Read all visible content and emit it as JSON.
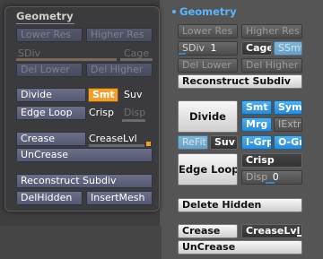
{
  "left_panel": {
    "title": "Geometry",
    "lower_res": "Lower Res",
    "higher_res": "Higher Res",
    "sdiv": "SDiv",
    "cage": "Cage",
    "del_lower": "Del Lower",
    "del_higher": "Del Higher",
    "divide": "Divide",
    "smt": "Smt",
    "suv": "Suv",
    "edge_loop": "Edge Loop",
    "crisp": "Crisp",
    "disp": "Disp",
    "crease": "Crease",
    "crease_lvl": "CreaseLvl",
    "uncrease": "UnCrease",
    "reconstruct_subdiv": "Reconstruct Subdiv",
    "del_hidden": "DelHidden",
    "insert_mesh": "InsertMesh"
  },
  "right_panel": {
    "title": "Geometry",
    "lower_res": "Lower Res",
    "higher_res": "Higher Res",
    "sdiv": "SDiv",
    "sdiv_value": "1",
    "cage": "Cage",
    "smt_disabled": "SSmt",
    "del_lower": "Del Lower",
    "del_higher": "Del Higher",
    "reconstruct_subdiv": "Reconstruct Subdiv",
    "divide": "Divide",
    "smt": "Smt",
    "sym": "Sym",
    "mrg": "Mrg",
    "iextr": "IExtr",
    "refit": "ReFit",
    "suv": "Suv",
    "i_grp": "I-Grp",
    "o_grp": "O-Grp",
    "edge_loop": "Edge Loop",
    "crisp": "Crisp",
    "disp": "Disp",
    "disp_value": "0",
    "delete_hidden": "Delete Hidden",
    "crease": "Crease",
    "crease_lvl": "CreaseLvl",
    "uncrease": "UnCrease"
  },
  "colors": {
    "accent_orange": "#f0a030",
    "accent_blue": "#2a8ad6",
    "title_blue": "#5ab6ff"
  }
}
